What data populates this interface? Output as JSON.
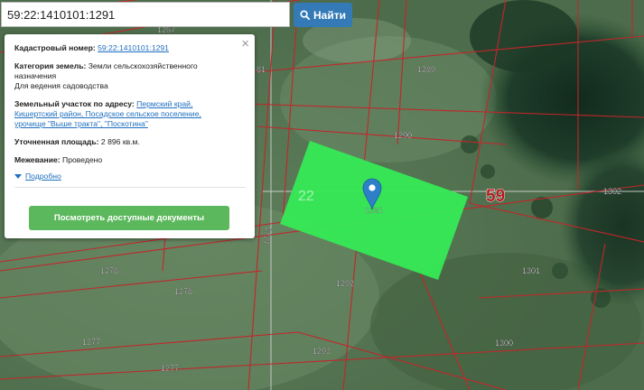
{
  "colors": {
    "parcel_highlight": "#35ea55",
    "boundary_line": "#c2262b",
    "search_button": "#337ab7",
    "docs_button": "#5cb85c",
    "link": "#1f6fbf"
  },
  "search": {
    "value": "59:22:1410101:1291",
    "button_label": "Найти",
    "icon": "magnifier-icon"
  },
  "popup": {
    "close_glyph": "×",
    "cadastral_label": "Кадастровый номер:",
    "cadastral_value": "59:22:1410101:1291",
    "category_label": "Категория земель:",
    "category_value": "Земли сельскохозяйственного",
    "category_value_cont": "назначения",
    "usage": "Для ведения садоводства",
    "address_label": "Земельный участок по адресу:",
    "address_link_1": "Пермский край,",
    "address_link_2": "Кишертский район, Посадское сельское поселение,",
    "address_link_3": "урочище \"Выше тракта\", \"Поскотина\"",
    "area_label": "Уточненная площадь:",
    "area_value": "2 896 кв.м.",
    "survey_label": "Межевание:",
    "survey_value": "Проведено",
    "details_label": "Подробно",
    "docs_button_label": "Посмотреть доступные документы"
  },
  "map": {
    "parcel_labels": {
      "p1289": "1289",
      "p1290": "1290",
      "p1302": "1302",
      "p1301": "1301",
      "p1292": "1292",
      "p1300": "1300",
      "p1293": "1293",
      "p1278a": "1278",
      "p1278b": "1278",
      "p1277a": "1277",
      "p1277b": "1277",
      "p1273": "1273",
      "p1267": "1267",
      "p81": "81",
      "sel": "1291"
    },
    "block_label_22": "22",
    "region_label": "59",
    "marker_icon": "map-pin-icon"
  }
}
